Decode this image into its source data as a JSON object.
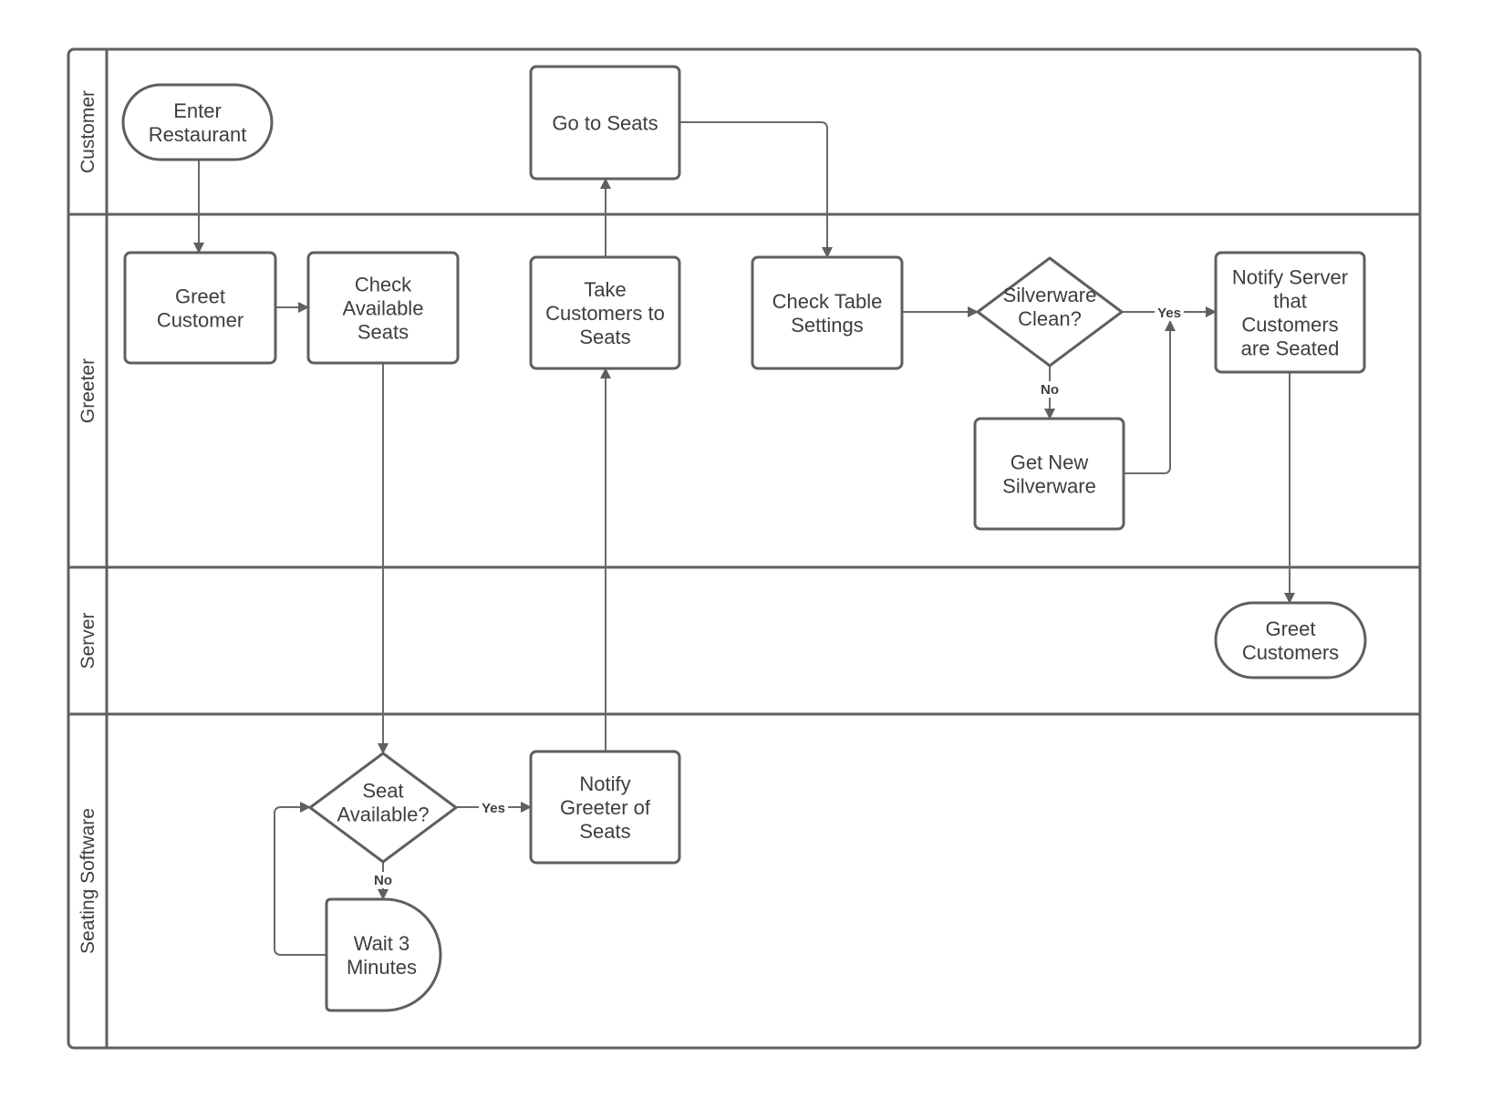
{
  "diagram": {
    "type": "swimlane-flowchart",
    "colors": {
      "stroke": "#5f5f5f",
      "text": "#3e3e3e",
      "background": "#ffffff"
    },
    "lanes": [
      {
        "id": "customer",
        "label": "Customer"
      },
      {
        "id": "greeter",
        "label": "Greeter"
      },
      {
        "id": "server",
        "label": "Server"
      },
      {
        "id": "seating",
        "label": "Seating Software"
      }
    ],
    "nodes": [
      {
        "id": "enter",
        "lane": "customer",
        "shape": "terminator",
        "lines": [
          "Enter",
          "Restaurant"
        ]
      },
      {
        "id": "goto",
        "lane": "customer",
        "shape": "process",
        "lines": [
          "Go to Seats"
        ]
      },
      {
        "id": "greet",
        "lane": "greeter",
        "shape": "process",
        "lines": [
          "Greet",
          "Customer"
        ]
      },
      {
        "id": "checkavail",
        "lane": "greeter",
        "shape": "process",
        "lines": [
          "Check",
          "Available",
          "Seats"
        ]
      },
      {
        "id": "take",
        "lane": "greeter",
        "shape": "process",
        "lines": [
          "Take",
          "Customers to",
          "Seats"
        ]
      },
      {
        "id": "checktable",
        "lane": "greeter",
        "shape": "process",
        "lines": [
          "Check Table",
          "Settings"
        ]
      },
      {
        "id": "silverclean",
        "lane": "greeter",
        "shape": "decision",
        "lines": [
          "Silverware",
          "Clean?"
        ]
      },
      {
        "id": "notifyserver",
        "lane": "greeter",
        "shape": "process",
        "lines": [
          "Notify Server",
          "that",
          "Customers",
          "are Seated"
        ]
      },
      {
        "id": "getnew",
        "lane": "greeter",
        "shape": "process",
        "lines": [
          "Get New",
          "Silverware"
        ]
      },
      {
        "id": "greetcust",
        "lane": "server",
        "shape": "terminator",
        "lines": [
          "Greet",
          "Customers"
        ]
      },
      {
        "id": "seatavail",
        "lane": "seating",
        "shape": "decision",
        "lines": [
          "Seat",
          "Available?"
        ]
      },
      {
        "id": "notifygreeter",
        "lane": "seating",
        "shape": "process",
        "lines": [
          "Notify",
          "Greeter of",
          "Seats"
        ]
      },
      {
        "id": "wait",
        "lane": "seating",
        "shape": "delay",
        "lines": [
          "Wait 3",
          "Minutes"
        ]
      }
    ],
    "edges": [
      {
        "from": "enter",
        "to": "greet",
        "label": ""
      },
      {
        "from": "greet",
        "to": "checkavail",
        "label": ""
      },
      {
        "from": "checkavail",
        "to": "seatavail",
        "label": ""
      },
      {
        "from": "seatavail",
        "to": "notifygreeter",
        "label": "Yes"
      },
      {
        "from": "seatavail",
        "to": "wait",
        "label": "No"
      },
      {
        "from": "wait",
        "to": "seatavail",
        "label": ""
      },
      {
        "from": "notifygreeter",
        "to": "take",
        "label": ""
      },
      {
        "from": "take",
        "to": "goto",
        "label": ""
      },
      {
        "from": "goto",
        "to": "checktable",
        "label": ""
      },
      {
        "from": "checktable",
        "to": "silverclean",
        "label": ""
      },
      {
        "from": "silverclean",
        "to": "notifyserver",
        "label": "Yes"
      },
      {
        "from": "silverclean",
        "to": "getnew",
        "label": "No"
      },
      {
        "from": "getnew",
        "to": "notifyserver",
        "label": ""
      },
      {
        "from": "notifyserver",
        "to": "greetcust",
        "label": ""
      }
    ]
  }
}
